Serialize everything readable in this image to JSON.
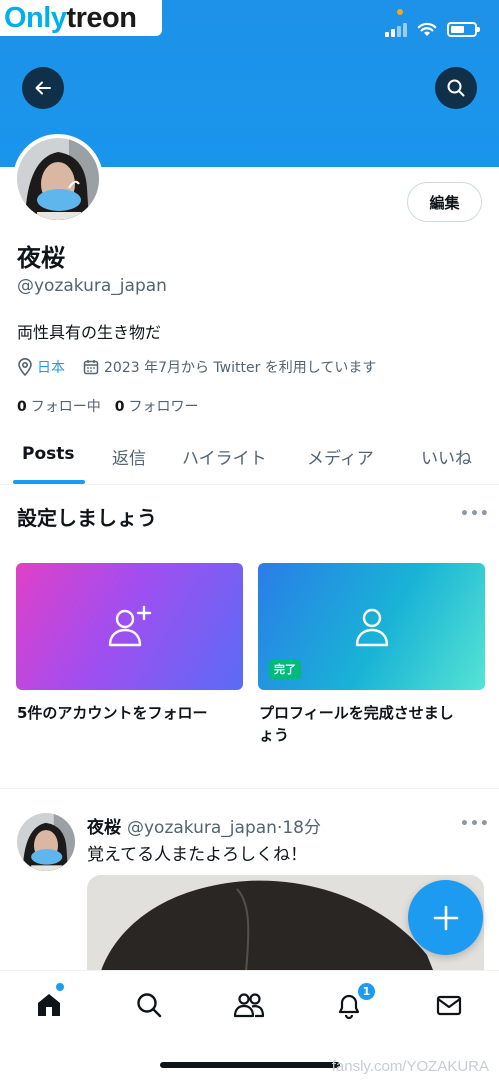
{
  "watermark_top": {
    "part1": "Only",
    "part2": "treon"
  },
  "profile": {
    "display_name": "夜桜",
    "handle": "@yozakura_japan",
    "bio": "両性具有の生き物だ",
    "location": "日本",
    "joined": "2023 年7月から Twitter を利用しています",
    "following_count": "0",
    "following_label": "フォロー中",
    "followers_count": "0",
    "followers_label": "フォロワー",
    "edit_label": "編集"
  },
  "tabs": [
    {
      "label": "Posts",
      "active": true
    },
    {
      "label": "返信"
    },
    {
      "label": "ハイライト"
    },
    {
      "label": "メディア"
    },
    {
      "label": "いいね"
    }
  ],
  "setup": {
    "title": "設定しましょう",
    "cards": [
      {
        "label": "5件のアカウントをフォロー",
        "icon": "person-add-icon"
      },
      {
        "label_line1": "プロフィールを完成させまし",
        "label_line2": "ょう",
        "badge": "完了",
        "icon": "person-icon"
      }
    ]
  },
  "tweet": {
    "name": "夜桜",
    "handle": "@yozakura_japan",
    "separator": "·",
    "time": "18分",
    "text": "覚えてる人またよろしくね！"
  },
  "nav": {
    "notification_count": "1",
    "items": [
      "home-icon",
      "search-icon",
      "communities-icon",
      "bell-icon",
      "mail-icon"
    ]
  },
  "watermark_bottom": "fansly.com/YOZAKURA",
  "colors": {
    "accent": "#1d9bf0",
    "banner": "#1d92e8",
    "done": "#00ba7c"
  }
}
